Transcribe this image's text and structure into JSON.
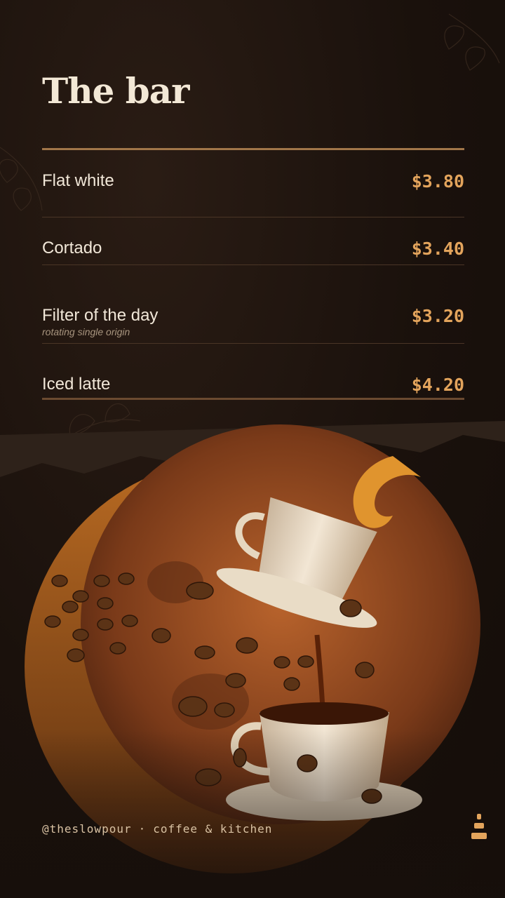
{
  "header": {
    "title": "The bar"
  },
  "menu": {
    "items": [
      {
        "name": "Flat white",
        "price": "$3.80",
        "note": ""
      },
      {
        "name": "Cortado",
        "price": "$3.40",
        "note": ""
      },
      {
        "name": "Filter of the day",
        "price": "$3.20",
        "note": "rotating single origin"
      },
      {
        "name": "Iced latte",
        "price": "$4.20",
        "note": ""
      }
    ]
  },
  "footer": {
    "handle": "@theslowpour",
    "separator": "·",
    "tagline": "coffee & kitchen"
  },
  "colors": {
    "background": "#170f0b",
    "accent": "#e3a45c",
    "text": "#f1e7d8",
    "rule": "#a17649"
  }
}
